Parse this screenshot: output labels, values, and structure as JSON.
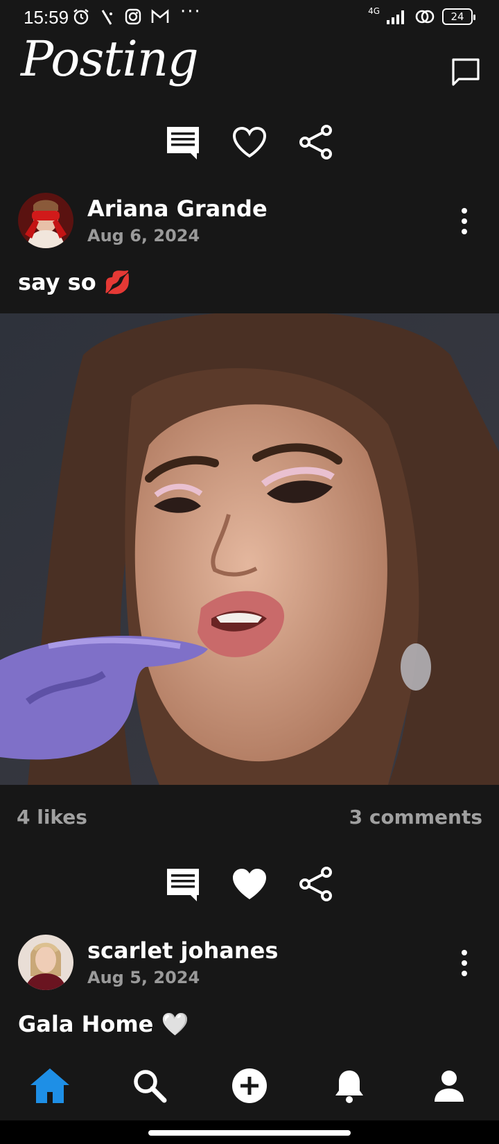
{
  "status_bar": {
    "time": "15:59",
    "network": "4G",
    "battery": "24",
    "more": "···"
  },
  "header": {
    "title": "Posting",
    "icons": [
      "message-square-icon"
    ]
  },
  "post_actions_top": {
    "icons": [
      "comment-icon",
      "heart-outline-icon",
      "share-icon"
    ]
  },
  "posts": [
    {
      "author": "Ariana Grande",
      "date": "Aug 6, 2024",
      "caption": "say so 💋",
      "likes": "4 likes",
      "comments": "3 comments",
      "liked": false
    },
    {
      "author": "scarlet johanes",
      "date": "Aug 5, 2024",
      "caption": "Gala Home 🤍",
      "liked": true
    }
  ],
  "bottom_nav": {
    "items": [
      "home-icon",
      "search-icon",
      "add-icon",
      "bell-icon",
      "profile-icon"
    ],
    "active": "home-icon",
    "active_color": "#1e8fe6"
  }
}
